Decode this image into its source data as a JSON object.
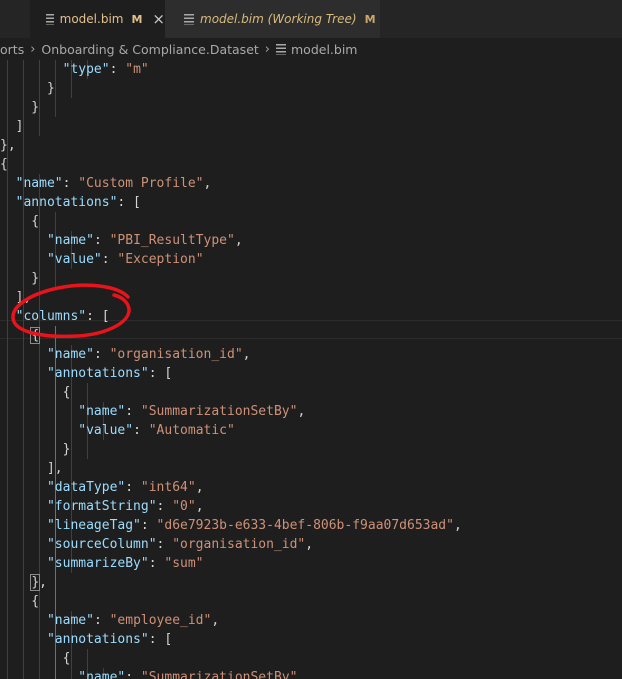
{
  "tabs": [
    {
      "label": "model.bim",
      "modified": "M",
      "close": "×"
    },
    {
      "label": "model.bim (Working Tree)",
      "modified": "M"
    }
  ],
  "breadcrumb": {
    "segments": [
      "orts",
      "Onboarding & Compliance.Dataset",
      "model.bim"
    ],
    "separator": "›"
  },
  "code_lines": [
    [
      {
        "t": "p",
        "v": "        "
      },
      {
        "t": "k",
        "v": "\"type\""
      },
      {
        "t": "p",
        "v": ": "
      },
      {
        "t": "s",
        "v": "\"m\""
      }
    ],
    [
      {
        "t": "p",
        "v": "      }"
      }
    ],
    [
      {
        "t": "p",
        "v": "    }"
      }
    ],
    [
      {
        "t": "p",
        "v": "  ]"
      }
    ],
    [
      {
        "t": "p",
        "v": "},"
      }
    ],
    [
      {
        "t": "p",
        "v": "{"
      }
    ],
    [
      {
        "t": "p",
        "v": "  "
      },
      {
        "t": "k",
        "v": "\"name\""
      },
      {
        "t": "p",
        "v": ": "
      },
      {
        "t": "s",
        "v": "\"Custom Profile\""
      },
      {
        "t": "p",
        "v": ","
      }
    ],
    [
      {
        "t": "p",
        "v": "  "
      },
      {
        "t": "k",
        "v": "\"annotations\""
      },
      {
        "t": "p",
        "v": ": ["
      }
    ],
    [
      {
        "t": "p",
        "v": "    {"
      }
    ],
    [
      {
        "t": "p",
        "v": "      "
      },
      {
        "t": "k",
        "v": "\"name\""
      },
      {
        "t": "p",
        "v": ": "
      },
      {
        "t": "s",
        "v": "\"PBI_ResultType\""
      },
      {
        "t": "p",
        "v": ","
      }
    ],
    [
      {
        "t": "p",
        "v": "      "
      },
      {
        "t": "k",
        "v": "\"value\""
      },
      {
        "t": "p",
        "v": ": "
      },
      {
        "t": "s",
        "v": "\"Exception\""
      }
    ],
    [
      {
        "t": "p",
        "v": "    }"
      }
    ],
    [
      {
        "t": "p",
        "v": "  ],"
      }
    ],
    [
      {
        "t": "p",
        "v": "  "
      },
      {
        "t": "k",
        "v": "\"columns\""
      },
      {
        "t": "p",
        "v": ": ["
      }
    ],
    [
      {
        "t": "p",
        "v": "    "
      },
      {
        "t": "b",
        "v": "{"
      }
    ],
    [
      {
        "t": "p",
        "v": "      "
      },
      {
        "t": "k",
        "v": "\"name\""
      },
      {
        "t": "p",
        "v": ": "
      },
      {
        "t": "s",
        "v": "\"organisation_id\""
      },
      {
        "t": "p",
        "v": ","
      }
    ],
    [
      {
        "t": "p",
        "v": "      "
      },
      {
        "t": "k",
        "v": "\"annotations\""
      },
      {
        "t": "p",
        "v": ": ["
      }
    ],
    [
      {
        "t": "p",
        "v": "        {"
      }
    ],
    [
      {
        "t": "p",
        "v": "          "
      },
      {
        "t": "k",
        "v": "\"name\""
      },
      {
        "t": "p",
        "v": ": "
      },
      {
        "t": "s",
        "v": "\"SummarizationSetBy\""
      },
      {
        "t": "p",
        "v": ","
      }
    ],
    [
      {
        "t": "p",
        "v": "          "
      },
      {
        "t": "k",
        "v": "\"value\""
      },
      {
        "t": "p",
        "v": ": "
      },
      {
        "t": "s",
        "v": "\"Automatic\""
      }
    ],
    [
      {
        "t": "p",
        "v": "        }"
      }
    ],
    [
      {
        "t": "p",
        "v": "      ],"
      }
    ],
    [
      {
        "t": "p",
        "v": "      "
      },
      {
        "t": "k",
        "v": "\"dataType\""
      },
      {
        "t": "p",
        "v": ": "
      },
      {
        "t": "s",
        "v": "\"int64\""
      },
      {
        "t": "p",
        "v": ","
      }
    ],
    [
      {
        "t": "p",
        "v": "      "
      },
      {
        "t": "k",
        "v": "\"formatString\""
      },
      {
        "t": "p",
        "v": ": "
      },
      {
        "t": "s",
        "v": "\"0\""
      },
      {
        "t": "p",
        "v": ","
      }
    ],
    [
      {
        "t": "p",
        "v": "      "
      },
      {
        "t": "k",
        "v": "\"lineageTag\""
      },
      {
        "t": "p",
        "v": ": "
      },
      {
        "t": "s",
        "v": "\"d6e7923b-e633-4bef-806b-f9aa07d653ad\""
      },
      {
        "t": "p",
        "v": ","
      }
    ],
    [
      {
        "t": "p",
        "v": "      "
      },
      {
        "t": "k",
        "v": "\"sourceColumn\""
      },
      {
        "t": "p",
        "v": ": "
      },
      {
        "t": "s",
        "v": "\"organisation_id\""
      },
      {
        "t": "p",
        "v": ","
      }
    ],
    [
      {
        "t": "p",
        "v": "      "
      },
      {
        "t": "k",
        "v": "\"summarizeBy\""
      },
      {
        "t": "p",
        "v": ": "
      },
      {
        "t": "s",
        "v": "\"sum\""
      }
    ],
    [
      {
        "t": "p",
        "v": "    "
      },
      {
        "t": "b",
        "v": "}"
      },
      {
        "t": "p",
        "v": ","
      }
    ],
    [
      {
        "t": "p",
        "v": "    {"
      }
    ],
    [
      {
        "t": "p",
        "v": "      "
      },
      {
        "t": "k",
        "v": "\"name\""
      },
      {
        "t": "p",
        "v": ": "
      },
      {
        "t": "s",
        "v": "\"employee_id\""
      },
      {
        "t": "p",
        "v": ","
      }
    ],
    [
      {
        "t": "p",
        "v": "      "
      },
      {
        "t": "k",
        "v": "\"annotations\""
      },
      {
        "t": "p",
        "v": ": ["
      }
    ],
    [
      {
        "t": "p",
        "v": "        {"
      }
    ],
    [
      {
        "t": "p",
        "v": "          "
      },
      {
        "t": "k",
        "v": "\"name\""
      },
      {
        "t": "p",
        "v": ": "
      },
      {
        "t": "s",
        "v": "\"SummarizationSetBy\""
      },
      {
        "t": "p",
        "v": ","
      }
    ]
  ],
  "colors": {
    "background": "#1e1e1e",
    "key": "#9cdcfe",
    "string": "#ce9178",
    "punctuation": "#d4d4d4",
    "modified": "#e2c08d",
    "annotation": "#e8131b"
  }
}
